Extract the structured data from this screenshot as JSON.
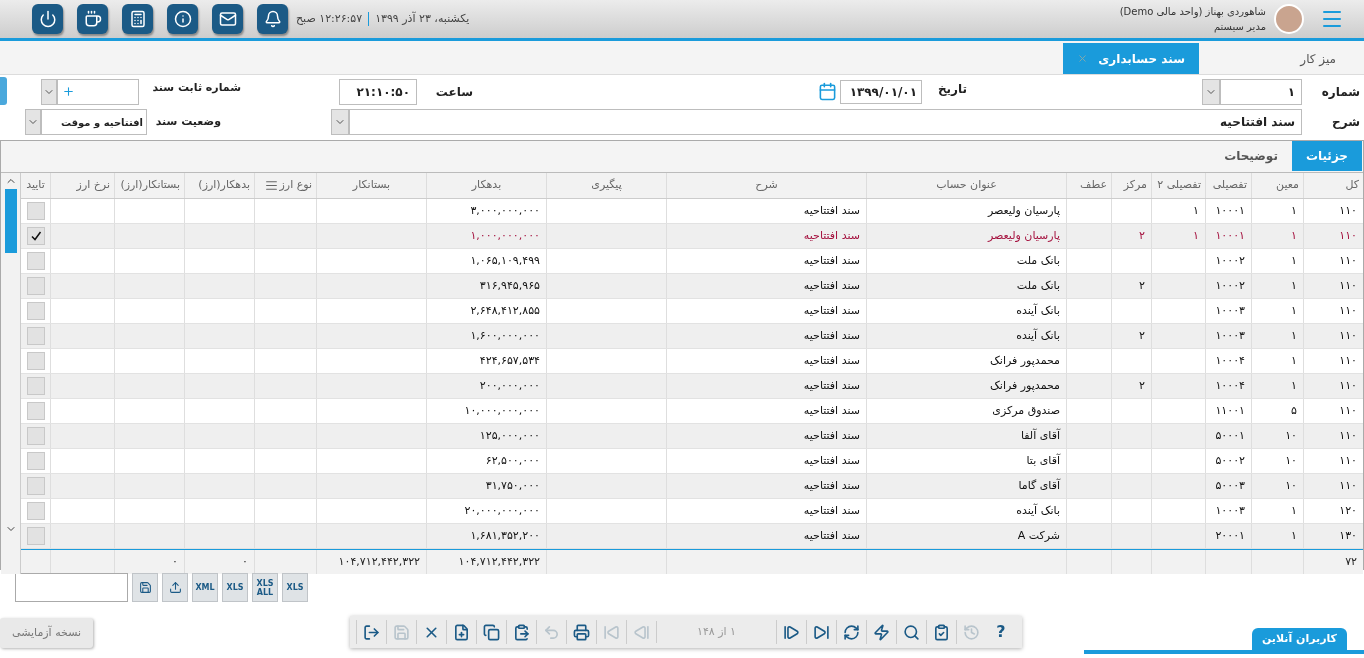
{
  "top_bar": {
    "user_name": "شاهوردی بهناز (واحد مالی Demo)",
    "user_role": "مدیر سیستم",
    "date": "یکشنبه، ۲۳ آذر ۱۳۹۹",
    "time": "۱۲:۲۶:۵۷ صبح",
    "icons": [
      {
        "kind": "bell"
      },
      {
        "kind": "mail"
      },
      {
        "kind": "info"
      },
      {
        "kind": "calculator"
      },
      {
        "kind": "cup"
      },
      {
        "kind": "power"
      }
    ]
  },
  "tabs": [
    {
      "label": "میز کار",
      "selected": false,
      "closable": false
    },
    {
      "label": "سند حسابداری",
      "selected": true,
      "closable": true
    }
  ],
  "form": {
    "number_label": "شماره",
    "number": "۱",
    "date_label": "تاریخ",
    "date": "۱۳۹۹/۰۱/۰۱",
    "time_label": "ساعت",
    "time": "۲۱:۱۰:۵۰",
    "fixed_number_label": "شماره ثابت سند",
    "description_label": "شرح",
    "description": "سند افتتاحیه",
    "status_label": "وضعیت سند",
    "status": "افتتاحیه و موقت"
  },
  "detail_tabs": [
    {
      "label": "جزئیات",
      "selected": true
    },
    {
      "label": "توضیحات",
      "selected": false
    }
  ],
  "table": {
    "columns": [
      {
        "label": "کل",
        "menu": false
      },
      {
        "label": "معین",
        "menu": false
      },
      {
        "label": "تفصیلی",
        "menu": false
      },
      {
        "label": "تفصیلی ۲",
        "menu": false
      },
      {
        "label": "مرکز",
        "menu": false
      },
      {
        "label": "عطف",
        "menu": false
      },
      {
        "label": "عنوان حساب",
        "menu": false
      },
      {
        "label": "شرح",
        "menu": false
      },
      {
        "label": "پیگیری",
        "menu": false
      },
      {
        "label": "بدهکار",
        "menu": false
      },
      {
        "label": "بستانکار",
        "menu": false
      },
      {
        "label": "نوع ارز",
        "menu": true
      },
      {
        "label": "بدهکار(ارز)",
        "menu": false
      },
      {
        "label": "بستانکار(ارز)",
        "menu": false
      },
      {
        "label": "نرخ ارز",
        "menu": false
      }
    ],
    "check_column": "تایید",
    "rows": [
      {
        "kol": "۱۱۰",
        "moin": "۱",
        "tafsili": "۱۰۰۰۱",
        "tafsili2": "۱",
        "account": "پارسیان ولیعصر",
        "desc": "سند افتتاحیه",
        "debit": "۳,۰۰۰,۰۰۰,۰۰۰",
        "checked": false,
        "selected": false
      },
      {
        "kol": "۱۱۰",
        "moin": "۱",
        "tafsili": "۱۰۰۰۱",
        "tafsili2": "۱",
        "markaz": "۲",
        "account": "پارسیان ولیعصر",
        "desc": "سند افتتاحیه",
        "debit": "۱,۰۰۰,۰۰۰,۰۰۰",
        "checked": true,
        "selected": true
      },
      {
        "kol": "۱۱۰",
        "moin": "۱",
        "tafsili": "۱۰۰۰۲",
        "account": "بانک ملت",
        "desc": "سند افتتاحیه",
        "debit": "۱,۰۶۵,۱۰۹,۴۹۹",
        "checked": false,
        "selected": false
      },
      {
        "kol": "۱۱۰",
        "moin": "۱",
        "tafsili": "۱۰۰۰۲",
        "markaz": "۲",
        "account": "بانک ملت",
        "desc": "سند افتتاحیه",
        "debit": "۳۱۶,۹۴۵,۹۶۵",
        "checked": false,
        "selected": false
      },
      {
        "kol": "۱۱۰",
        "moin": "۱",
        "tafsili": "۱۰۰۰۳",
        "account": "بانک آینده",
        "desc": "سند افتتاحیه",
        "debit": "۲,۶۴۸,۴۱۲,۸۵۵",
        "checked": false,
        "selected": false
      },
      {
        "kol": "۱۱۰",
        "moin": "۱",
        "tafsili": "۱۰۰۰۳",
        "markaz": "۲",
        "account": "بانک آینده",
        "desc": "سند افتتاحیه",
        "debit": "۱,۶۰۰,۰۰۰,۰۰۰",
        "checked": false,
        "selected": false
      },
      {
        "kol": "۱۱۰",
        "moin": "۱",
        "tafsili": "۱۰۰۰۴",
        "account": "محمدپور فرانک",
        "desc": "سند افتتاحیه",
        "debit": "۴۲۴,۶۵۷,۵۳۴",
        "checked": false,
        "selected": false
      },
      {
        "kol": "۱۱۰",
        "moin": "۱",
        "tafsili": "۱۰۰۰۴",
        "markaz": "۲",
        "account": "محمدپور فرانک",
        "desc": "سند افتتاحیه",
        "debit": "۲۰۰,۰۰۰,۰۰۰",
        "checked": false,
        "selected": false
      },
      {
        "kol": "۱۱۰",
        "moin": "۵",
        "tafsili": "۱۱۰۰۱",
        "account": "صندوق مرکزی",
        "desc": "سند افتتاحیه",
        "debit": "۱۰,۰۰۰,۰۰۰,۰۰۰",
        "checked": false,
        "selected": false
      },
      {
        "kol": "۱۱۰",
        "moin": "۱۰",
        "tafsili": "۵۰۰۰۱",
        "account": "آقای آلفا",
        "desc": "سند افتتاحیه",
        "debit": "۱۲۵,۰۰۰,۰۰۰",
        "checked": false,
        "selected": false
      },
      {
        "kol": "۱۱۰",
        "moin": "۱۰",
        "tafsili": "۵۰۰۰۲",
        "account": "آقای بتا",
        "desc": "سند افتتاحیه",
        "debit": "۶۲,۵۰۰,۰۰۰",
        "checked": false,
        "selected": false
      },
      {
        "kol": "۱۱۰",
        "moin": "۱۰",
        "tafsili": "۵۰۰۰۳",
        "account": "آقای گاما",
        "desc": "سند افتتاحیه",
        "debit": "۳۱,۷۵۰,۰۰۰",
        "checked": false,
        "selected": false
      },
      {
        "kol": "۱۲۰",
        "moin": "۱",
        "tafsili": "۱۰۰۰۳",
        "account": "بانک آینده",
        "desc": "سند افتتاحیه",
        "debit": "۲۰,۰۰۰,۰۰۰,۰۰۰",
        "checked": false,
        "selected": false
      },
      {
        "kol": "۱۳۰",
        "moin": "۱",
        "tafsili": "۲۰۰۰۱",
        "account": "شرکت A",
        "desc": "سند افتتاحیه",
        "debit": "۱,۶۸۱,۳۵۲,۲۰۰",
        "checked": false,
        "selected": false
      }
    ],
    "totals": {
      "kol": "۷۲",
      "debit": "۱۰۴,۷۱۲,۴۴۲,۳۲۲",
      "credit": "۱۰۴,۷۱۲,۴۴۲,۳۲۲",
      "debit_fx": "۰",
      "credit_fx": "۰"
    }
  },
  "export_buttons": [
    {
      "kind": "file",
      "label": "XLS"
    },
    {
      "kind": "file",
      "label": "XLS ALL"
    },
    {
      "kind": "file",
      "label": "XLS"
    },
    {
      "kind": "file",
      "label": "XML"
    },
    {
      "kind": "import"
    },
    {
      "kind": "save"
    }
  ],
  "trial_badge": "نسخه آزمایشی",
  "toolbar": [
    {
      "kind": "text",
      "label": "?",
      "disabled": false
    },
    {
      "kind": "history",
      "disabled": true
    },
    {
      "kind": "approve",
      "disabled": false
    },
    {
      "kind": "search",
      "disabled": false
    },
    {
      "kind": "flash",
      "disabled": false
    },
    {
      "kind": "refresh",
      "disabled": false
    },
    {
      "kind": "last",
      "disabled": false
    },
    {
      "kind": "next",
      "disabled": false
    },
    {
      "kind": "pager",
      "label": "۱ از ۱۴۸",
      "disabled": true
    },
    {
      "kind": "prev",
      "disabled": true
    },
    {
      "kind": "first",
      "disabled": true
    },
    {
      "kind": "print",
      "disabled": false
    },
    {
      "kind": "undo",
      "disabled": true
    },
    {
      "kind": "paste",
      "disabled": false
    },
    {
      "kind": "copy",
      "disabled": false
    },
    {
      "kind": "new",
      "disabled": false
    },
    {
      "kind": "delete",
      "disabled": false
    },
    {
      "kind": "save",
      "disabled": true
    },
    {
      "kind": "exit",
      "disabled": false
    }
  ],
  "online_users_tab": "کاربران آنلاین"
}
